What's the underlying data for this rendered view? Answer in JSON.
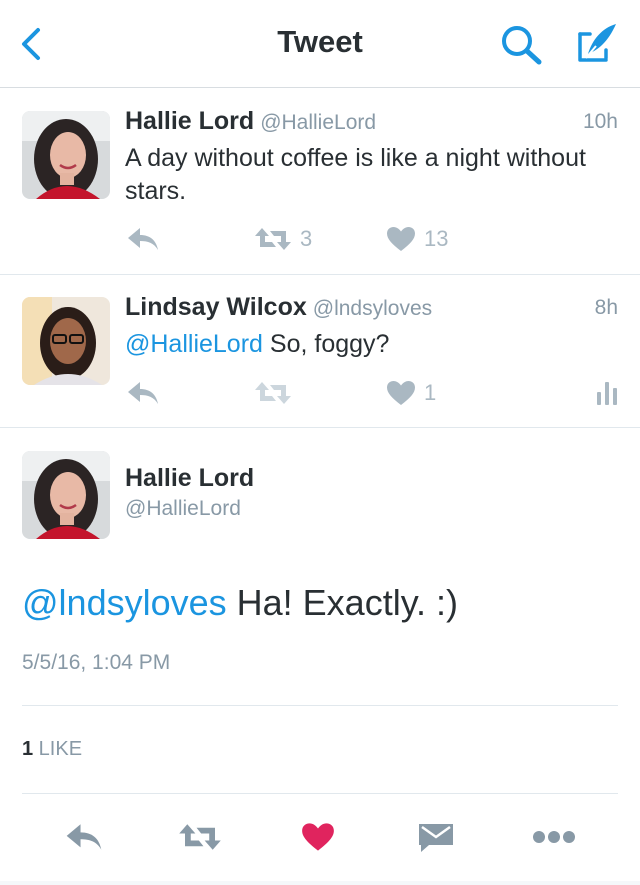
{
  "colors": {
    "accent": "#1b95e0",
    "like": "#e0245e",
    "muted": "#aab8c2",
    "text": "#292f33",
    "secondary": "#8899a6"
  },
  "nav": {
    "title": "Tweet",
    "icons": [
      "back-chevron-icon",
      "search-icon",
      "compose-icon"
    ]
  },
  "tweets": [
    {
      "name": "Hallie Lord",
      "handle": "@HallieLord",
      "time": "10h",
      "text": "A day without coffee is like a night without stars.",
      "retweets": "3",
      "likes": "13"
    },
    {
      "name": "Lindsay Wilcox",
      "handle": "@lndsyloves",
      "time": "8h",
      "mention": "@HallieLord",
      "text": " So, foggy?",
      "retweets": "",
      "likes": "1"
    }
  ],
  "detail": {
    "name": "Hallie Lord",
    "handle": "@HallieLord",
    "mention": "@lndsyloves",
    "text": " Ha! Exactly. :)",
    "date": "5/5/16, 1:04 PM",
    "like_count": "1",
    "like_label": " LIKE"
  },
  "bottom_actions": [
    "reply-icon",
    "retweet-icon",
    "heart-icon",
    "message-icon",
    "more-icon"
  ]
}
